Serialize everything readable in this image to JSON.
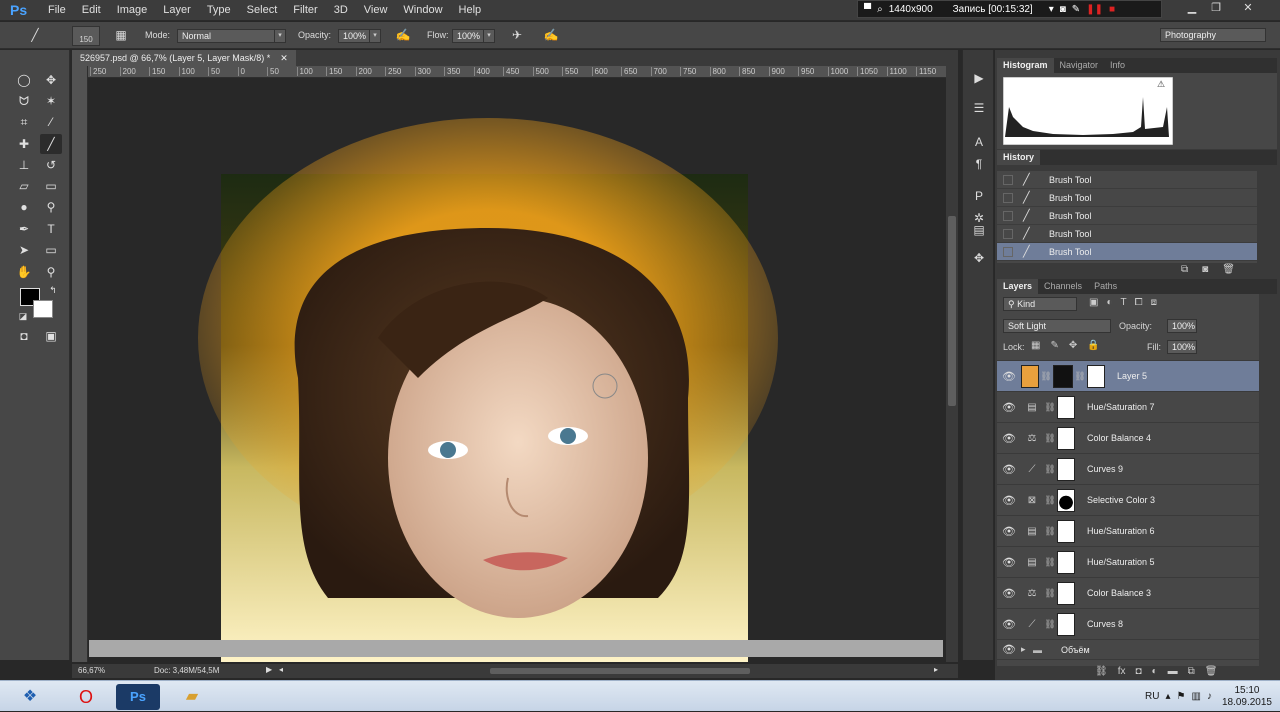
{
  "app": {
    "logo": "Ps"
  },
  "menu": [
    "File",
    "Edit",
    "Image",
    "Layer",
    "Type",
    "Select",
    "Filter",
    "3D",
    "View",
    "Window",
    "Help"
  ],
  "recorder": {
    "resolution": "1440x900",
    "status": "Запись [00:15:32]"
  },
  "options": {
    "brush_size": "150",
    "mode_label": "Mode:",
    "mode_value": "Normal",
    "opacity_label": "Opacity:",
    "opacity_value": "100%",
    "flow_label": "Flow:",
    "flow_value": "100%",
    "workspace": "Photography"
  },
  "document": {
    "tab_title": "526957.psd @ 66,7% (Layer 5, Layer Mask/8) *",
    "zoom": "66,67%",
    "doc_info": "Doc: 3,48M/54,5M",
    "ruler_ticks": [
      "250",
      "200",
      "150",
      "100",
      "50",
      "0",
      "50",
      "100",
      "150",
      "200",
      "250",
      "300",
      "350",
      "400",
      "450",
      "500",
      "550",
      "600",
      "650",
      "700",
      "750",
      "800",
      "850",
      "900",
      "950",
      "1000",
      "1050",
      "1100",
      "1150",
      "1200"
    ]
  },
  "histogram_panel": {
    "tabs": [
      "Histogram",
      "Navigator",
      "Info"
    ],
    "active": "Histogram"
  },
  "history_panel": {
    "title": "History",
    "items": [
      "Brush Tool",
      "Brush Tool",
      "Brush Tool",
      "Brush Tool",
      "Brush Tool"
    ]
  },
  "layers_panel": {
    "tabs": [
      "Layers",
      "Channels",
      "Paths"
    ],
    "kind_label": "Kind",
    "blend_mode": "Soft Light",
    "opacity_label": "Opacity:",
    "opacity_value": "100%",
    "lock_label": "Lock:",
    "fill_label": "Fill:",
    "fill_value": "100%",
    "layers": [
      {
        "name": "Layer 5",
        "selected": true
      },
      {
        "name": "Hue/Saturation 7"
      },
      {
        "name": "Color Balance 4"
      },
      {
        "name": "Curves 9"
      },
      {
        "name": "Selective Color 3"
      },
      {
        "name": "Hue/Saturation 6"
      },
      {
        "name": "Hue/Saturation 5"
      },
      {
        "name": "Color Balance 3"
      },
      {
        "name": "Curves 8"
      },
      {
        "name": "Объём"
      }
    ]
  },
  "taskbar": {
    "lang": "RU",
    "time": "15:10",
    "date": "18.09.2015"
  },
  "colors": {
    "accent": "#6f7d99",
    "ps_blue": "#4aa3ff"
  }
}
